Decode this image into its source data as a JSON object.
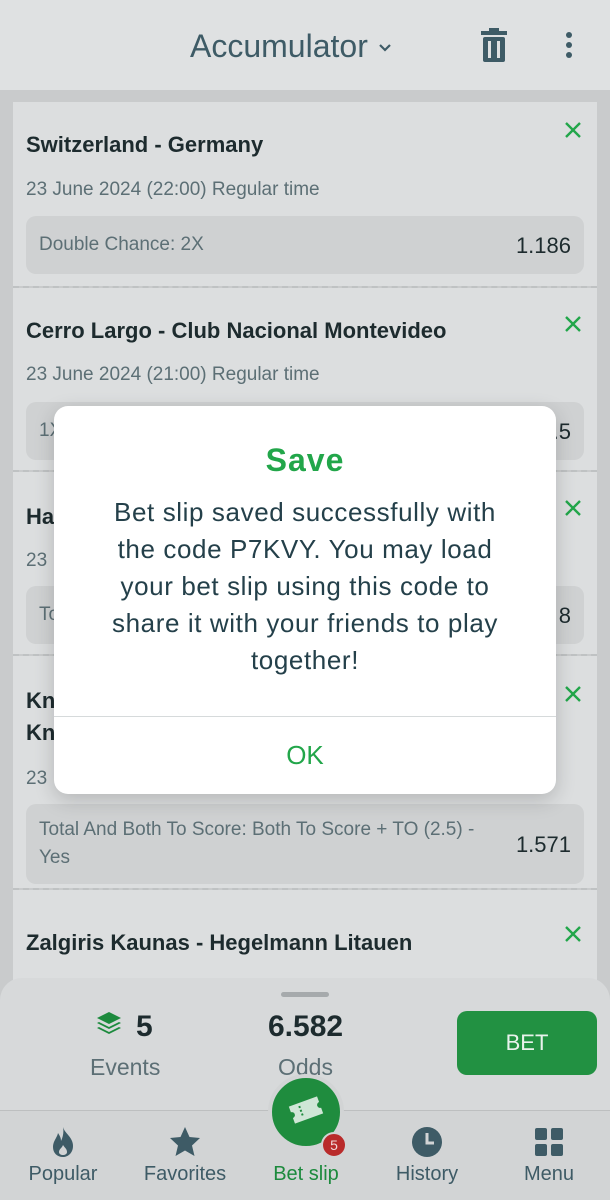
{
  "header": {
    "title": "Accumulator"
  },
  "bets": [
    {
      "match": "Switzerland - Germany",
      "date": "23 June 2024 (22:00) Regular time",
      "market": "Double Chance: 2X",
      "odd": "1.186"
    },
    {
      "match": "Cerro Largo - Club Nacional Montevideo",
      "date": "23 June 2024 (21:00) Regular time",
      "market": "1X",
      "odd": "1.5"
    },
    {
      "match": "Ha",
      "date": "23",
      "market": "To",
      "odd": "8"
    },
    {
      "match_line1": "Kn",
      "match_line2": "Kn",
      "date": "23",
      "market": "Total And Both To Score: Both To Score + TO (2.5) - Yes",
      "odd": "1.571"
    },
    {
      "match": "Zalgiris Kaunas - Hegelmann Litauen"
    }
  ],
  "summary": {
    "events_count": "5",
    "events_label": "Events",
    "odds_value": "6.582",
    "odds_label": "Odds",
    "bet_label": "BET"
  },
  "nav": {
    "items": [
      {
        "label": "Popular"
      },
      {
        "label": "Favorites"
      },
      {
        "label": "Bet slip"
      },
      {
        "label": "History"
      },
      {
        "label": "Menu"
      }
    ],
    "badge": "5"
  },
  "dialog": {
    "title": "Save",
    "message": "Bet slip saved successfully with the code P7KVY. You may load your bet slip using this code to share it with your friends to play together!",
    "ok_label": "OK"
  },
  "colors": {
    "accent": "#22a64a",
    "bet_button": "#229142",
    "badge": "#b92b2b"
  }
}
